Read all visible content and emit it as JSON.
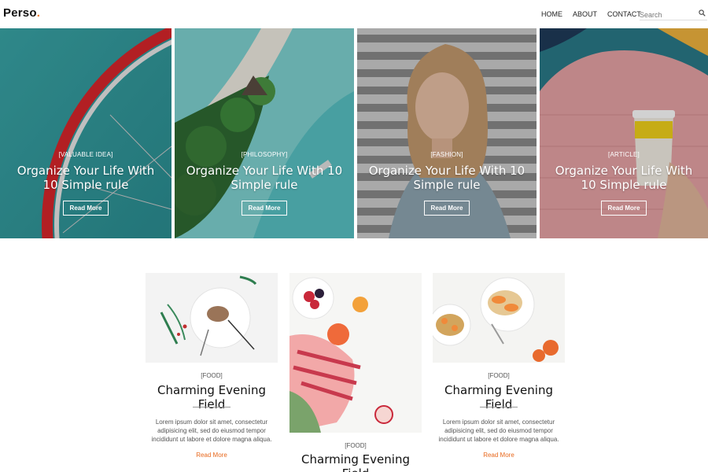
{
  "header": {
    "logo": "Perso",
    "logo_dot": ".",
    "nav": [
      "HOME",
      "ABOUT",
      "CONTACT"
    ],
    "search_placeholder": "Search"
  },
  "hero": [
    {
      "category": "[VALUABLE IDEA]",
      "title": "Organize Your Life With 10 Simple rule",
      "button": "Read More"
    },
    {
      "category": "[PHILOSOPHY]",
      "title": "Organize Your Life With 10 Simple rule",
      "button": "Read More"
    },
    {
      "category": "[FASHION]",
      "title": "Organize Your Life With 10 Simple rule",
      "button": "Read More"
    },
    {
      "category": "[ARTICLE]",
      "title": "Organize Your Life With 10 Simple rule",
      "button": "Read More"
    }
  ],
  "posts": [
    {
      "category": "[FOOD]",
      "title": "Charming Evening Field",
      "excerpt": "Lorem ipsum dolor sit amet, consectetur adipisicing elit, sed do eiusmod tempor incididunt ut labore et dolore magna aliqua.",
      "more": "Read More"
    },
    {
      "category": "[FOOD]",
      "title": "Charming Evening Field"
    },
    {
      "category": "[FOOD]",
      "title": "Charming Evening Field",
      "excerpt": "Lorem ipsum dolor sit amet, consectetur adipisicing elit, sed do eiusmod tempor incididunt ut labore et dolore magna aliqua.",
      "more": "Read More"
    }
  ],
  "colors": {
    "accent": "#f07a2a",
    "read_more": "#e8691e"
  }
}
